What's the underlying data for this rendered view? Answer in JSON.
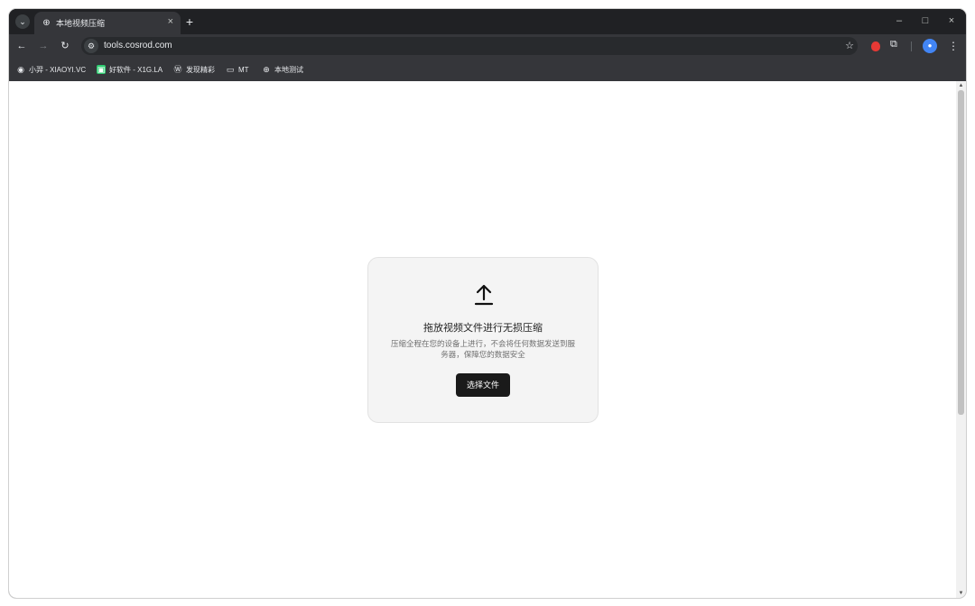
{
  "browser": {
    "tab": {
      "title": "本地视频压缩",
      "close": "×"
    },
    "new_tab": "+",
    "window_controls": {
      "minimize": "–",
      "maximize": "□",
      "close": "×"
    },
    "nav": {
      "back": "←",
      "forward": "→",
      "reload": "↻"
    },
    "address": {
      "site_info_icon": "tune-icon",
      "url": "tools.cosrod.com",
      "star": "☆"
    },
    "menu": "⋮"
  },
  "bookmarks": [
    {
      "label": "小羿 - XIAOYI.VC",
      "icon": "avatar-icon",
      "color": "#e8eaed"
    },
    {
      "label": "好软件 - X1G.LA",
      "icon": "app-icon",
      "color": "#2ecc71"
    },
    {
      "label": "发现精彩",
      "icon": "wordpress-icon",
      "color": "#e8eaed"
    },
    {
      "label": "MT",
      "icon": "folder-icon",
      "color": "#e8eaed"
    },
    {
      "label": "本地测试",
      "icon": "globe-icon",
      "color": "#e8eaed"
    }
  ],
  "page": {
    "title": "拖放视频文件进行无损压缩",
    "description": "压缩全程在您的设备上进行，不会将任何数据发送到服务器，保障您的数据安全",
    "button": "选择文件"
  }
}
